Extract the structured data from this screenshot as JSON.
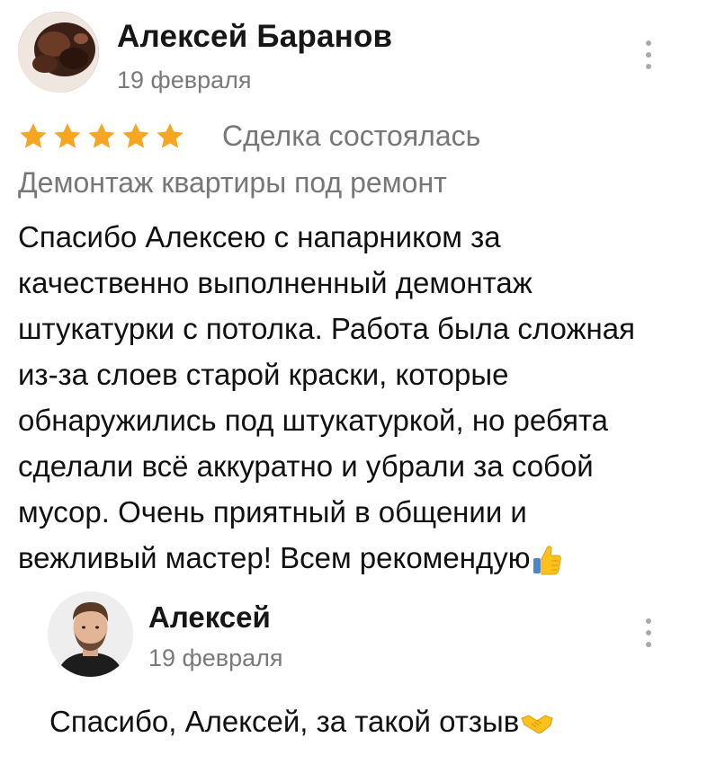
{
  "review": {
    "author": "Алексей Баранов",
    "date": "19 февраля",
    "rating": 5,
    "rating_max": 5,
    "deal_status": "Сделка состоялась",
    "service": "Демонтаж квартиры под ремонт",
    "text_lines": [
      "Спасибо Алексею с напарником за",
      "качественно выполненный демонтаж",
      "штукатурки с потолка. Работа была сложная",
      "из-за слоев старой краски, которые",
      "обнаружились под штукатуркой, но ребята",
      "сделали всё аккуратно и убрали за собой",
      "мусор. Очень приятный в общении и",
      "вежливый мастер! Всем рекомендую"
    ],
    "text_emoji": "thumbs-up-icon"
  },
  "reply": {
    "author": "Алексей",
    "date": "19 февраля",
    "text": "Спасибо,  Алексей,  за такой отзыв",
    "text_emoji": "handshake-icon"
  },
  "colors": {
    "star": "#f5a623",
    "secondary_text": "#777777",
    "menu_dots": "#a9a9a9"
  },
  "icons": {
    "menu": "more-vertical-icon",
    "star": "star-icon"
  }
}
